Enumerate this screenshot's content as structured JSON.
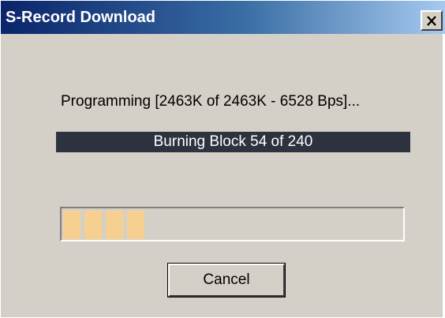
{
  "window": {
    "title": "S-Record Download"
  },
  "title_bar": {
    "close_icon": "close-icon"
  },
  "status": {
    "text": "Programming [2463K of 2463K - 6528 Bps]..."
  },
  "block_banner": {
    "text": "Burning Block 54 of 240"
  },
  "progress": {
    "fraction": 0.25,
    "fill_color": "#f5d090"
  },
  "buttons": {
    "cancel_label": "Cancel"
  },
  "colors": {
    "window_bg": "#d4d0c8",
    "title_start": "#0a246a",
    "title_end": "#a6caf0",
    "banner_bg": "#2d333e"
  }
}
